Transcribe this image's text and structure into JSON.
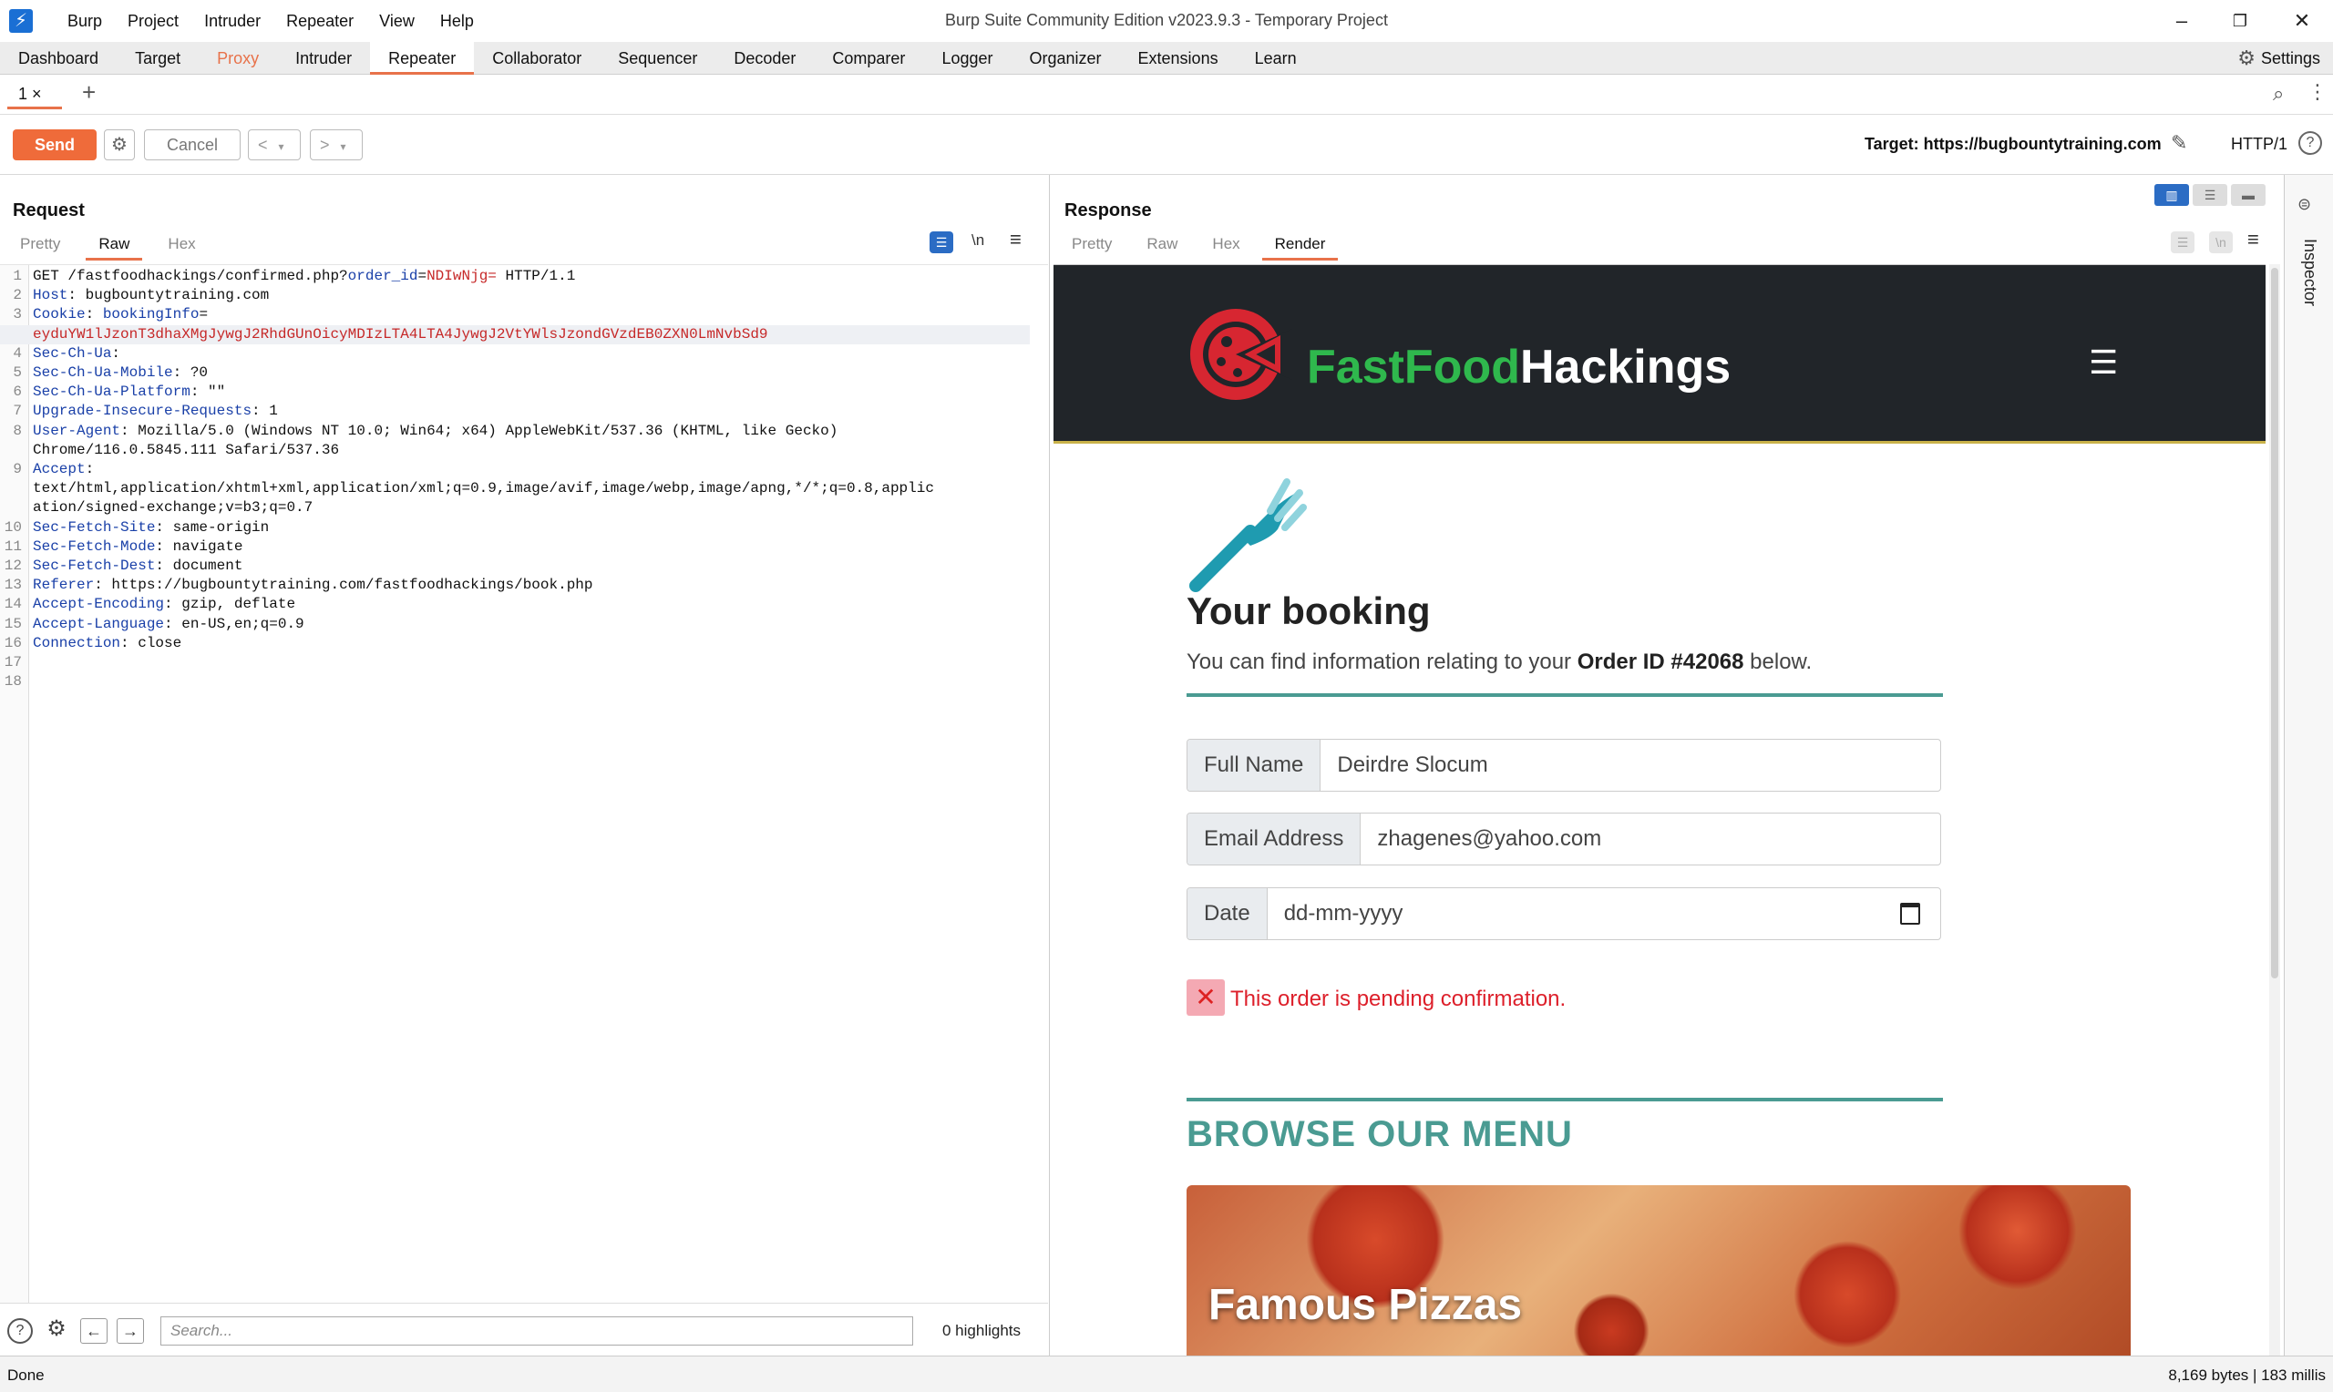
{
  "window": {
    "title": "Burp Suite Community Edition v2023.9.3 - Temporary Project",
    "menu": [
      "Burp",
      "Project",
      "Intruder",
      "Repeater",
      "View",
      "Help"
    ]
  },
  "tool_tabs": [
    "Dashboard",
    "Target",
    "Proxy",
    "Intruder",
    "Repeater",
    "Collaborator",
    "Sequencer",
    "Decoder",
    "Comparer",
    "Logger",
    "Organizer",
    "Extensions",
    "Learn"
  ],
  "active_tool_tab": "Repeater",
  "settings_label": "Settings",
  "repeater": {
    "tab_label": "1 ×",
    "add_tab": "+"
  },
  "toolbar": {
    "send": "Send",
    "cancel": "Cancel",
    "back": "<",
    "forward": ">",
    "target": "Target: https://bugbountytraining.com",
    "protocol": "HTTP/1"
  },
  "request": {
    "title": "Request",
    "tabs": [
      "Pretty",
      "Raw",
      "Hex"
    ],
    "active_tab": "Raw",
    "lines": [
      {
        "n": "1",
        "parts": [
          [
            "v",
            "GET /fastfoodhackings/confirmed.php?"
          ],
          [
            "k",
            "order_id"
          ],
          [
            "v",
            "="
          ],
          [
            "r",
            "NDIwNjg="
          ],
          [
            "v",
            " HTTP/1.1"
          ]
        ]
      },
      {
        "n": "2",
        "parts": [
          [
            "k",
            "Host"
          ],
          [
            "v",
            ": bugbountytraining.com"
          ]
        ]
      },
      {
        "n": "3",
        "parts": [
          [
            "k",
            "Cookie"
          ],
          [
            "v",
            ": "
          ],
          [
            "k",
            "bookingInfo"
          ],
          [
            "v",
            "="
          ]
        ]
      },
      {
        "n": "",
        "parts": [
          [
            "r",
            "eyduYW1lJzonT3dhaXMgJywgJ2RhdGUnOicyMDIzLTA4LTA4JywgJ2VtYWlsJzondGVzdEB0ZXN0LmNvbSd9"
          ]
        ],
        "hl": true
      },
      {
        "n": "4",
        "parts": [
          [
            "k",
            "Sec-Ch-Ua"
          ],
          [
            "v",
            ":"
          ]
        ]
      },
      {
        "n": "5",
        "parts": [
          [
            "k",
            "Sec-Ch-Ua-Mobile"
          ],
          [
            "v",
            ": ?0"
          ]
        ]
      },
      {
        "n": "6",
        "parts": [
          [
            "k",
            "Sec-Ch-Ua-Platform"
          ],
          [
            "v",
            ": \"\""
          ]
        ]
      },
      {
        "n": "7",
        "parts": [
          [
            "k",
            "Upgrade-Insecure-Requests"
          ],
          [
            "v",
            ": 1"
          ]
        ]
      },
      {
        "n": "8",
        "parts": [
          [
            "k",
            "User-Agent"
          ],
          [
            "v",
            ": Mozilla/5.0 (Windows NT 10.0; Win64; x64) AppleWebKit/537.36 (KHTML, like Gecko)"
          ]
        ]
      },
      {
        "n": "",
        "parts": [
          [
            "v",
            "Chrome/116.0.5845.111 Safari/537.36"
          ]
        ]
      },
      {
        "n": "9",
        "parts": [
          [
            "k",
            "Accept"
          ],
          [
            "v",
            ":"
          ]
        ]
      },
      {
        "n": "",
        "parts": [
          [
            "v",
            "text/html,application/xhtml+xml,application/xml;q=0.9,image/avif,image/webp,image/apng,*/*;q=0.8,applic"
          ]
        ]
      },
      {
        "n": "",
        "parts": [
          [
            "v",
            "ation/signed-exchange;v=b3;q=0.7"
          ]
        ]
      },
      {
        "n": "10",
        "parts": [
          [
            "k",
            "Sec-Fetch-Site"
          ],
          [
            "v",
            ": same-origin"
          ]
        ]
      },
      {
        "n": "11",
        "parts": [
          [
            "k",
            "Sec-Fetch-Mode"
          ],
          [
            "v",
            ": navigate"
          ]
        ]
      },
      {
        "n": "12",
        "parts": [
          [
            "k",
            "Sec-Fetch-Dest"
          ],
          [
            "v",
            ": document"
          ]
        ]
      },
      {
        "n": "13",
        "parts": [
          [
            "k",
            "Referer"
          ],
          [
            "v",
            ": https://bugbountytraining.com/fastfoodhackings/book.php"
          ]
        ]
      },
      {
        "n": "14",
        "parts": [
          [
            "k",
            "Accept-Encoding"
          ],
          [
            "v",
            ": gzip, deflate"
          ]
        ]
      },
      {
        "n": "15",
        "parts": [
          [
            "k",
            "Accept-Language"
          ],
          [
            "v",
            ": en-US,en;q=0.9"
          ]
        ]
      },
      {
        "n": "16",
        "parts": [
          [
            "k",
            "Connection"
          ],
          [
            "v",
            ": close"
          ]
        ]
      },
      {
        "n": "17",
        "parts": []
      },
      {
        "n": "18",
        "parts": []
      }
    ],
    "search_placeholder": "Search...",
    "highlights": "0 highlights"
  },
  "response": {
    "title": "Response",
    "tabs": [
      "Pretty",
      "Raw",
      "Hex",
      "Render"
    ],
    "active_tab": "Render",
    "site": {
      "brand_green": "FastFood",
      "brand_white": "Hackings",
      "heading": "Your booking",
      "intro_before": "You can find information relating to your ",
      "intro_bold": "Order ID #42068",
      "intro_after": " below.",
      "fields": [
        {
          "label": "Full Name",
          "value": "Deirdre Slocum"
        },
        {
          "label": "Email Address",
          "value": "zhagenes@yahoo.com"
        },
        {
          "label": "Date",
          "value": "dd-mm-yyyy"
        }
      ],
      "error_icon": "✕",
      "error_text": "This order is pending confirmation.",
      "browse_heading": "BROWSE OUR MENU",
      "card_title": "Famous Pizzas"
    }
  },
  "inspector_label": "Inspector",
  "status": {
    "left": "Done",
    "right": "8,169 bytes | 183 millis"
  },
  "colors": {
    "accent": "#e8724a",
    "send": "#ef6b3a",
    "teal": "#4a9b92",
    "brand_green": "#2fb84d",
    "error_red": "#dd1f2a"
  }
}
